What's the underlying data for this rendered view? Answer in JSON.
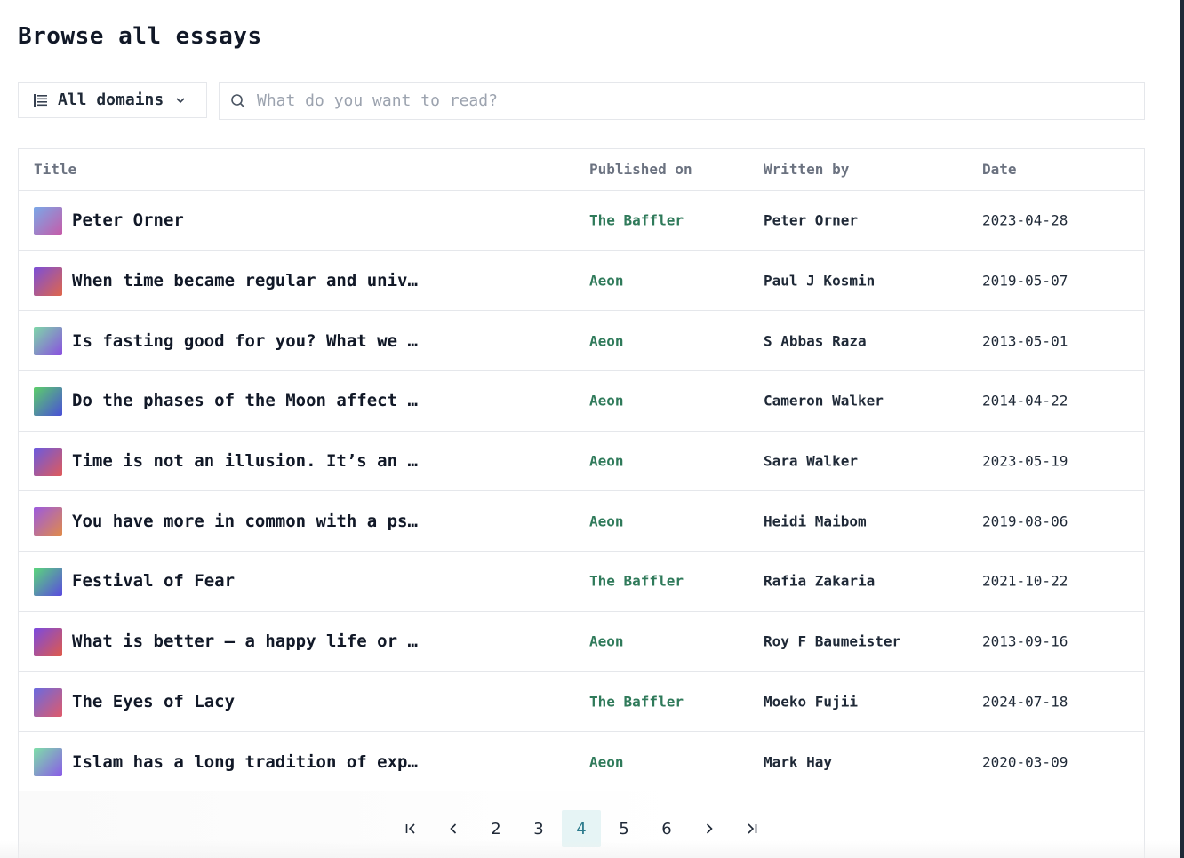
{
  "header": {
    "title": "Browse all essays"
  },
  "filters": {
    "domain_label": "All domains",
    "search_placeholder": "What do you want to read?"
  },
  "table": {
    "columns": [
      "Title",
      "Published on",
      "Written by",
      "Date"
    ],
    "rows": [
      {
        "title": "Peter Orner",
        "publication": "The Baffler",
        "author": "Peter Orner",
        "date": "2023-04-28",
        "thumb_gradient": [
          "#7aa8e8",
          "#c75aa8"
        ]
      },
      {
        "title": "When time became regular and unive…",
        "publication": "Aeon",
        "author": "Paul J Kosmin",
        "date": "2019-05-07",
        "thumb_gradient": [
          "#7b4fd8",
          "#e0664a"
        ]
      },
      {
        "title": "Is fasting good for you? What we k…",
        "publication": "Aeon",
        "author": "S Abbas Raza",
        "date": "2013-05-01",
        "thumb_gradient": [
          "#7ed8a8",
          "#8a4fe0"
        ]
      },
      {
        "title": "Do the phases of the Moon affect h…",
        "publication": "Aeon",
        "author": "Cameron Walker",
        "date": "2014-04-22",
        "thumb_gradient": [
          "#5ccf6a",
          "#4a4fd8"
        ]
      },
      {
        "title": "Time is not an illusion. It’s an o…",
        "publication": "Aeon",
        "author": "Sara Walker",
        "date": "2023-05-19",
        "thumb_gradient": [
          "#6a5ae0",
          "#e05a5a"
        ]
      },
      {
        "title": "You have more in common with a psy…",
        "publication": "Aeon",
        "author": "Heidi Maibom",
        "date": "2019-08-06",
        "thumb_gradient": [
          "#9b5ae0",
          "#e08a4a"
        ]
      },
      {
        "title": "Festival of Fear",
        "publication": "The Baffler",
        "author": "Rafia Zakaria",
        "date": "2021-10-22",
        "thumb_gradient": [
          "#5ad87a",
          "#5a4ae0"
        ]
      },
      {
        "title": "What is better – a happy life or a…",
        "publication": "Aeon",
        "author": "Roy F Baumeister",
        "date": "2013-09-16",
        "thumb_gradient": [
          "#7a4ae0",
          "#e05a4a"
        ]
      },
      {
        "title": "The Eyes of Lacy",
        "publication": "The Baffler",
        "author": "Moeko Fujii",
        "date": "2024-07-18",
        "thumb_gradient": [
          "#6a6ae0",
          "#e05a6a"
        ]
      },
      {
        "title": "Islam has a long tradition of expl…",
        "publication": "Aeon",
        "author": "Mark Hay",
        "date": "2020-03-09",
        "thumb_gradient": [
          "#7ee0a8",
          "#8a5ae8"
        ]
      }
    ]
  },
  "pagination": {
    "first_icon": "first-page-icon",
    "prev_icon": "chevron-left-icon",
    "pages": [
      "2",
      "3",
      "4",
      "5",
      "6"
    ],
    "current": "4",
    "next_icon": "chevron-right-icon",
    "last_icon": "last-page-icon"
  },
  "colors": {
    "publication_text": "#2f7a5a",
    "active_page_bg": "#e6f4f5",
    "border": "#e5e7eb"
  }
}
